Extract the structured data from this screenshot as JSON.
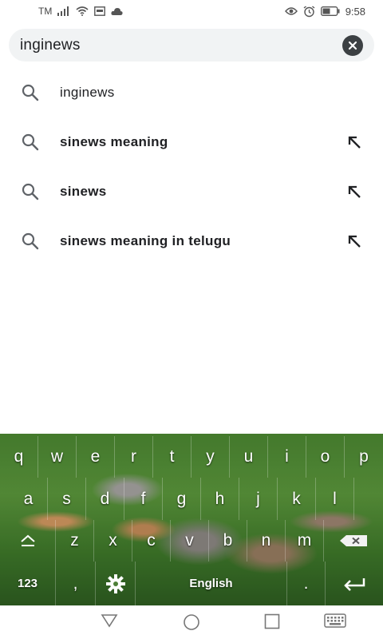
{
  "status_bar": {
    "carrier": "TM",
    "time": "9:58"
  },
  "search": {
    "query": "inginews"
  },
  "suggestions": [
    {
      "text": "inginews",
      "bold": false,
      "has_arrow": false
    },
    {
      "text": "sinews meaning",
      "bold": true,
      "has_arrow": true
    },
    {
      "text": "sinews",
      "bold": true,
      "has_arrow": true
    },
    {
      "text": "sinews meaning in telugu",
      "bold": true,
      "has_arrow": true
    }
  ],
  "keyboard": {
    "row1": [
      "q",
      "w",
      "e",
      "r",
      "t",
      "y",
      "u",
      "i",
      "o",
      "p"
    ],
    "row2": [
      "a",
      "s",
      "d",
      "f",
      "g",
      "h",
      "j",
      "k",
      "l"
    ],
    "row3": [
      "z",
      "x",
      "c",
      "v",
      "b",
      "n",
      "m"
    ],
    "numbers_label": "123",
    "comma": ",",
    "space_label": "English",
    "period": "."
  },
  "colors": {
    "search_bg": "#f1f3f4",
    "text": "#202124",
    "icon": "#5f6368"
  }
}
